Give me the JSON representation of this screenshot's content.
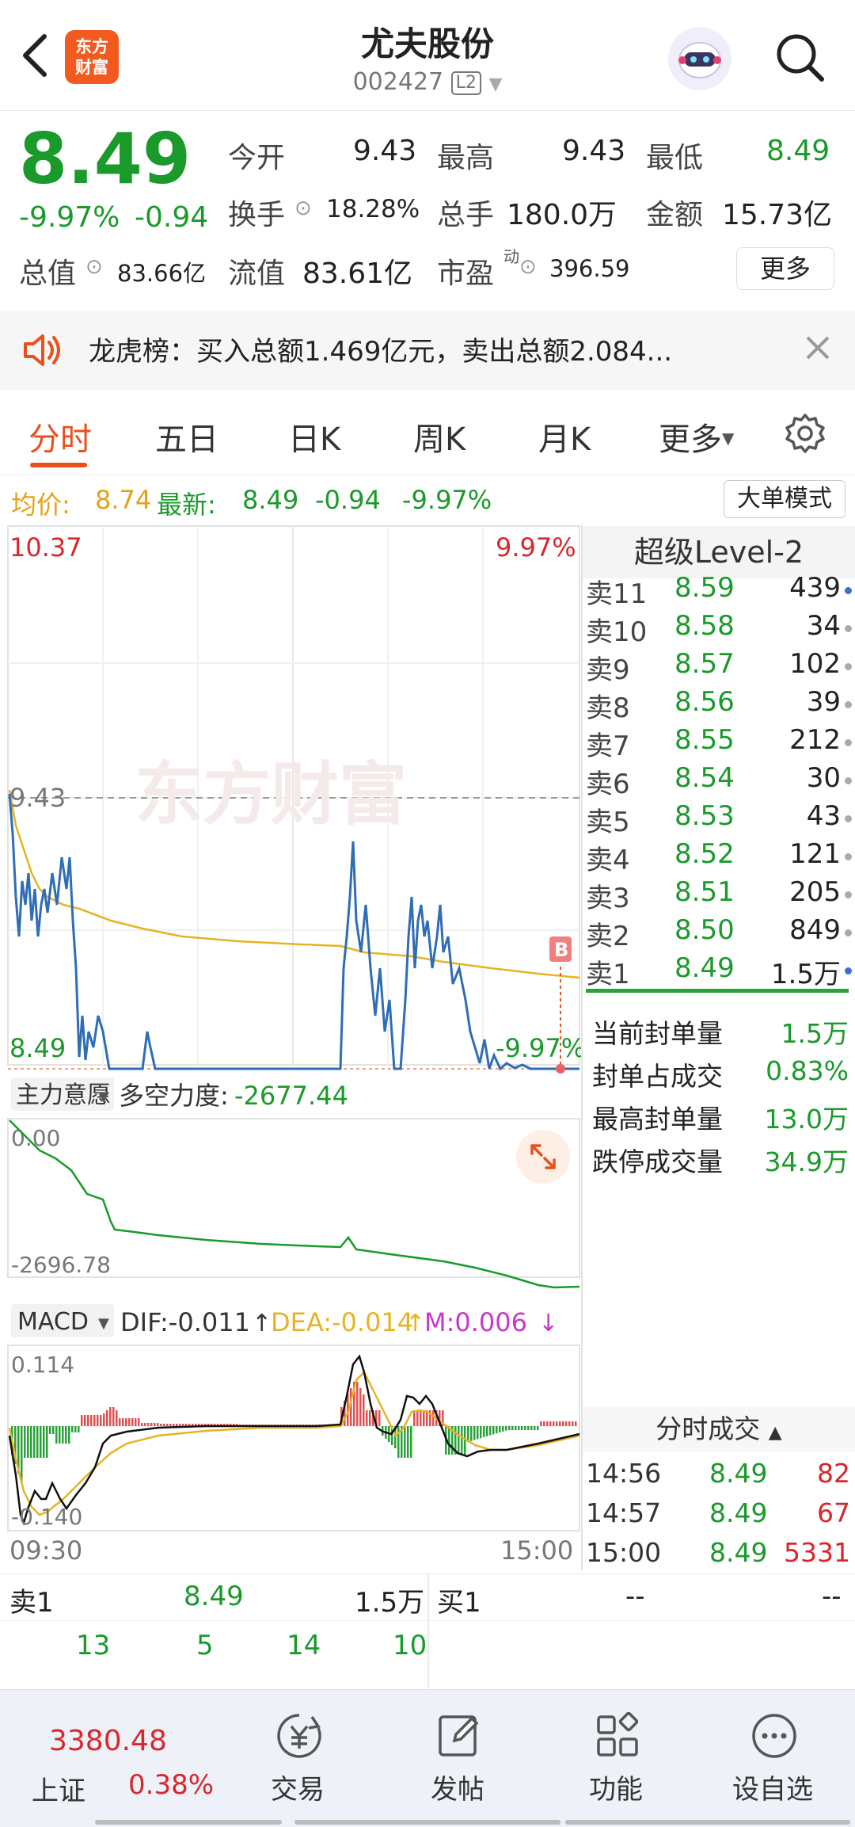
{
  "header": {
    "back_icon": "chevron-left-icon",
    "logo_line1": "东方",
    "logo_line2": "财富",
    "stock_name": "尤夫股份",
    "stock_code": "002427",
    "level_badge": "L2",
    "search_icon": "search-icon"
  },
  "quote": {
    "price": "8.49",
    "change_pct": "-9.97%",
    "change": "-0.94",
    "open_label": "今开",
    "open": "9.43",
    "high_label": "最高",
    "high": "9.43",
    "low_label": "最低",
    "low": "8.49",
    "turnover_label": "换手",
    "turnover": "18.28%",
    "volume_label": "总手",
    "volume": "180.0万",
    "amount_label": "金额",
    "amount": "15.73亿",
    "mktcap_label": "总值",
    "mktcap": "83.66亿",
    "float_label": "流值",
    "float": "83.61亿",
    "pe_label": "市盈",
    "pe_sup": "动",
    "pe": "396.59",
    "more_button": "更多"
  },
  "banner": {
    "text": "龙虎榜：买入总额1.469亿元，卖出总额2.084..."
  },
  "tabs": [
    {
      "label": "分时"
    },
    {
      "label": "五日"
    },
    {
      "label": "日K"
    },
    {
      "label": "周K"
    },
    {
      "label": "月K"
    },
    {
      "label": "更多"
    }
  ],
  "info_row": {
    "avg_label": "均价:",
    "avg": "8.74",
    "latest_label": "最新:",
    "latest": "8.49",
    "change": "-0.94",
    "change_pct": "-9.97%",
    "big_order_button": "大单模式"
  },
  "intraday": {
    "y_top": "10.37",
    "y_top_pct": "9.97%",
    "y_mid": "9.43",
    "y_bottom": "8.49",
    "y_bottom_pct": "-9.97%",
    "marker": "B",
    "watermark": "东方财富"
  },
  "indicator1": {
    "selector": "主力意愿",
    "label": "多空力度:",
    "value": "-2677.44",
    "y_top": "0.00",
    "y_bottom": "-2696.78"
  },
  "macd": {
    "selector": "MACD",
    "dif": "DIF:-0.011",
    "dea": "DEA:-0.014",
    "m": "M:0.006",
    "y_top": "0.114",
    "y_bottom": "-0.140",
    "x_start": "09:30",
    "x_end": "15:00"
  },
  "level2": {
    "title": "超级Level-2",
    "asks": [
      {
        "label": "卖11",
        "price": "8.59",
        "vol": "439",
        "dot": "#3a6fd8"
      },
      {
        "label": "卖10",
        "price": "8.58",
        "vol": "34",
        "dot": "#aaaaaa"
      },
      {
        "label": "卖9",
        "price": "8.57",
        "vol": "102",
        "dot": "#aaaaaa"
      },
      {
        "label": "卖8",
        "price": "8.56",
        "vol": "39",
        "dot": "#aaaaaa"
      },
      {
        "label": "卖7",
        "price": "8.55",
        "vol": "212",
        "dot": "#aaaaaa"
      },
      {
        "label": "卖6",
        "price": "8.54",
        "vol": "30",
        "dot": "#aaaaaa"
      },
      {
        "label": "卖5",
        "price": "8.53",
        "vol": "43",
        "dot": "#aaaaaa"
      },
      {
        "label": "卖4",
        "price": "8.52",
        "vol": "121",
        "dot": "#aaaaaa"
      },
      {
        "label": "卖3",
        "price": "8.51",
        "vol": "205",
        "dot": "#aaaaaa"
      },
      {
        "label": "卖2",
        "price": "8.50",
        "vol": "849",
        "dot": "#aaaaaa"
      },
      {
        "label": "卖1",
        "price": "8.49",
        "vol": "1.5万",
        "dot": "#3a6fd8"
      }
    ],
    "stats": [
      {
        "label": "当前封单量",
        "value": "1.5万"
      },
      {
        "label": "封单占成交",
        "value": "0.83%"
      },
      {
        "label": "最高封单量",
        "value": "13.0万"
      },
      {
        "label": "跌停成交量",
        "value": "34.9万"
      }
    ]
  },
  "trades": {
    "title": "分时成交",
    "rows": [
      {
        "time": "14:56",
        "price": "8.49",
        "vol": "82"
      },
      {
        "time": "14:57",
        "price": "8.49",
        "vol": "67"
      },
      {
        "time": "15:00",
        "price": "8.49",
        "vol": "5331"
      }
    ]
  },
  "lower": {
    "sell_label": "卖1",
    "sell_price": "8.49",
    "sell_vol": "1.5万",
    "buy_label": "买1",
    "buy_price": "--",
    "buy_vol": "--",
    "row2": [
      "13",
      "5",
      "14",
      "10"
    ]
  },
  "nav": {
    "index_value": "3380.48",
    "index_name": "上证",
    "index_change": "0.38%",
    "items": [
      {
        "label": "交易",
        "icon": "trade-yen-icon"
      },
      {
        "label": "发帖",
        "icon": "post-edit-icon"
      },
      {
        "label": "功能",
        "icon": "apps-grid-icon"
      },
      {
        "label": "设自选",
        "icon": "more-dots-icon"
      }
    ]
  },
  "colors": {
    "up": "#d9262c",
    "down": "#1a9a2a",
    "accent": "#e8501c",
    "price_line": "#2f6db5",
    "avg_line": "#e6b422"
  }
}
